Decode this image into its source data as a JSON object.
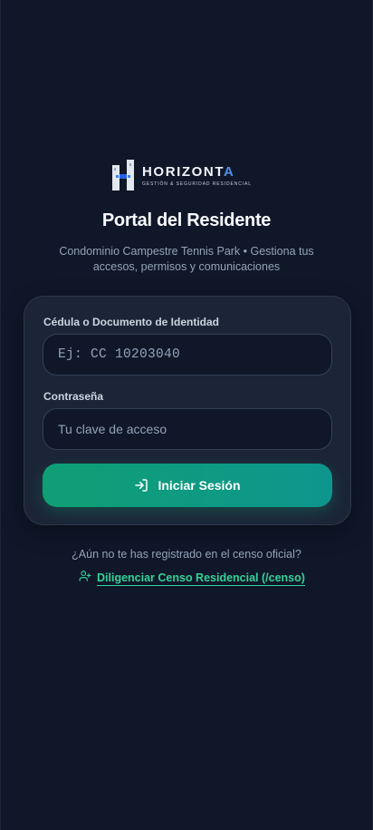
{
  "logo": {
    "brand_main": "HORIZONT",
    "brand_accent": "A",
    "tagline": "GESTIÓN & SEGURIDAD RESIDENCIAL"
  },
  "header": {
    "title": "Portal del Residente",
    "subtitle": "Condominio Campestre Tennis Park • Gestiona tus accesos, permisos y comunicaciones"
  },
  "form": {
    "id_label": "Cédula o Documento de Identidad",
    "id_placeholder": "Ej: CC 10203040",
    "password_label": "Contraseña",
    "password_placeholder": "Tu clave de acceso",
    "submit_label": "Iniciar Sesión",
    "submit_icon": "login-icon"
  },
  "register": {
    "question": "¿Aún no te has registrado en el censo oficial?",
    "link_label": "Diligenciar Censo Residencial (/censo)",
    "link_icon": "user-plus-icon"
  },
  "colors": {
    "background": "#0f1729",
    "card": "#1b2537",
    "accent_green": "#10b981",
    "link_green": "#34d399",
    "brand_blue": "#4f8fe8"
  }
}
